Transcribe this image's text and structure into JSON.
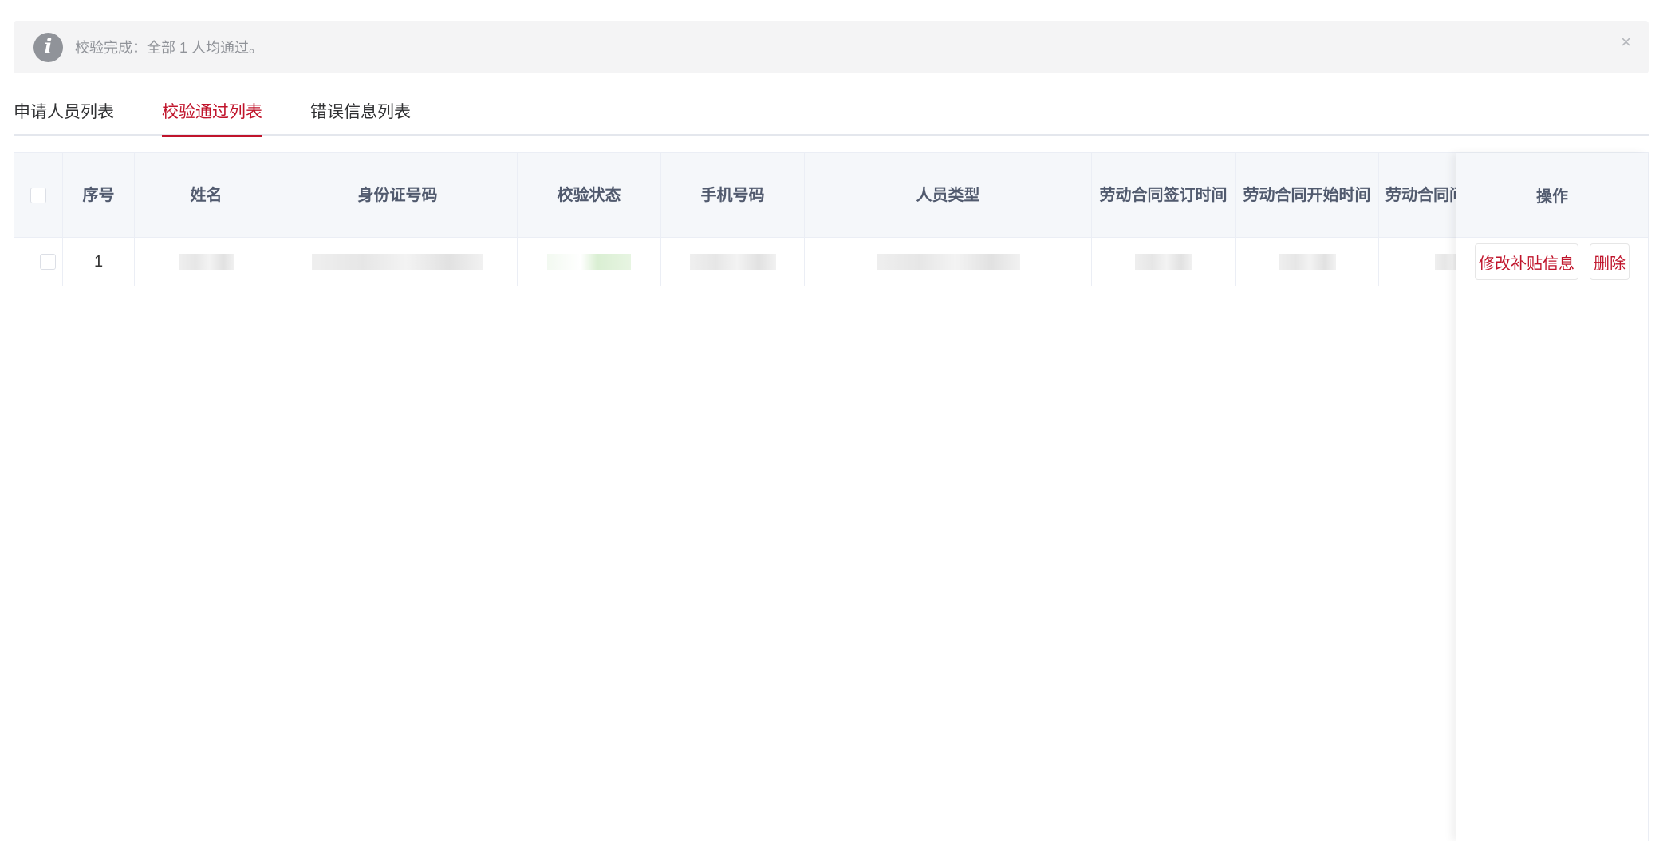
{
  "alert": {
    "icon": "info-icon",
    "icon_glyph": "i",
    "message": "校验完成：全部 1 人均通过。",
    "close": "×"
  },
  "tabs": [
    {
      "label": "申请人员列表",
      "active": false
    },
    {
      "label": "校验通过列表",
      "active": true
    },
    {
      "label": "错误信息列表",
      "active": false
    }
  ],
  "table": {
    "headers": {
      "index": "序号",
      "name": "姓名",
      "id_number": "身份证号码",
      "check_status": "校验状态",
      "phone": "手机号码",
      "person_type": "人员类型",
      "contract_sign": "劳动合同签订时间",
      "contract_start": "劳动合同开始时间",
      "contract_end": "劳动合同间",
      "actions": "操作"
    },
    "rows": [
      {
        "index": "1",
        "actions": {
          "edit": "修改补贴信息",
          "delete": "删除"
        }
      }
    ]
  },
  "colors": {
    "accent": "#c0142b",
    "header_bg": "#f5f7fa",
    "alert_bg": "#f4f4f5"
  }
}
